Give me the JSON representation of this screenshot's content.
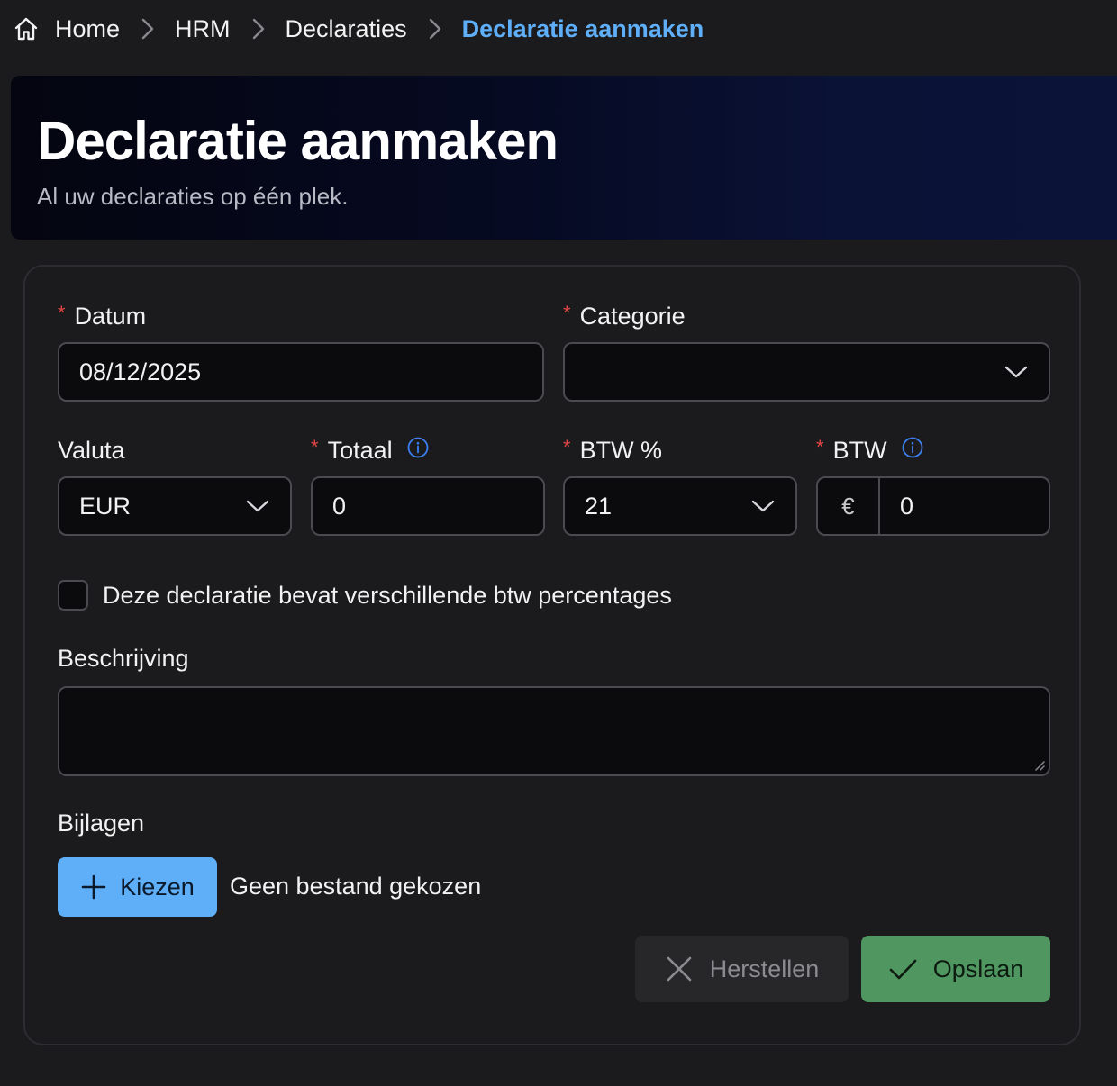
{
  "breadcrumb": {
    "home": "Home",
    "hrm": "HRM",
    "declarations": "Declaraties",
    "current": "Declaratie aanmaken"
  },
  "hero": {
    "title": "Declaratie aanmaken",
    "subtitle": "Al uw declaraties op één plek."
  },
  "form": {
    "required_marker": "*",
    "date": {
      "label": "Datum",
      "value": "08/12/2025"
    },
    "category": {
      "label": "Categorie",
      "value": ""
    },
    "currency": {
      "label": "Valuta",
      "value": "EUR"
    },
    "total": {
      "label": "Totaal",
      "value": "0"
    },
    "vat_percent": {
      "label": "BTW %",
      "value": "21"
    },
    "vat": {
      "label": "BTW",
      "prefix": "€",
      "value": "0"
    },
    "multi_vat_checkbox": {
      "label": "Deze declaratie bevat verschillende btw percentages",
      "checked": false
    },
    "description": {
      "label": "Beschrijving",
      "value": ""
    },
    "attachments": {
      "label": "Bijlagen",
      "choose_label": "Kiezen",
      "no_file": "Geen bestand gekozen"
    }
  },
  "actions": {
    "reset_label": "Herstellen",
    "save_label": "Opslaan"
  },
  "colors": {
    "background": "#1b1b1d",
    "accent": "#5eaef8",
    "required": "#e64545",
    "save": "#4f9660",
    "info": "#3d7ff0"
  },
  "icons": [
    "home-icon",
    "chevron-right-icon",
    "chevron-down-icon",
    "info-icon",
    "plus-icon",
    "close-icon",
    "check-icon",
    "resize-grip-icon"
  ]
}
